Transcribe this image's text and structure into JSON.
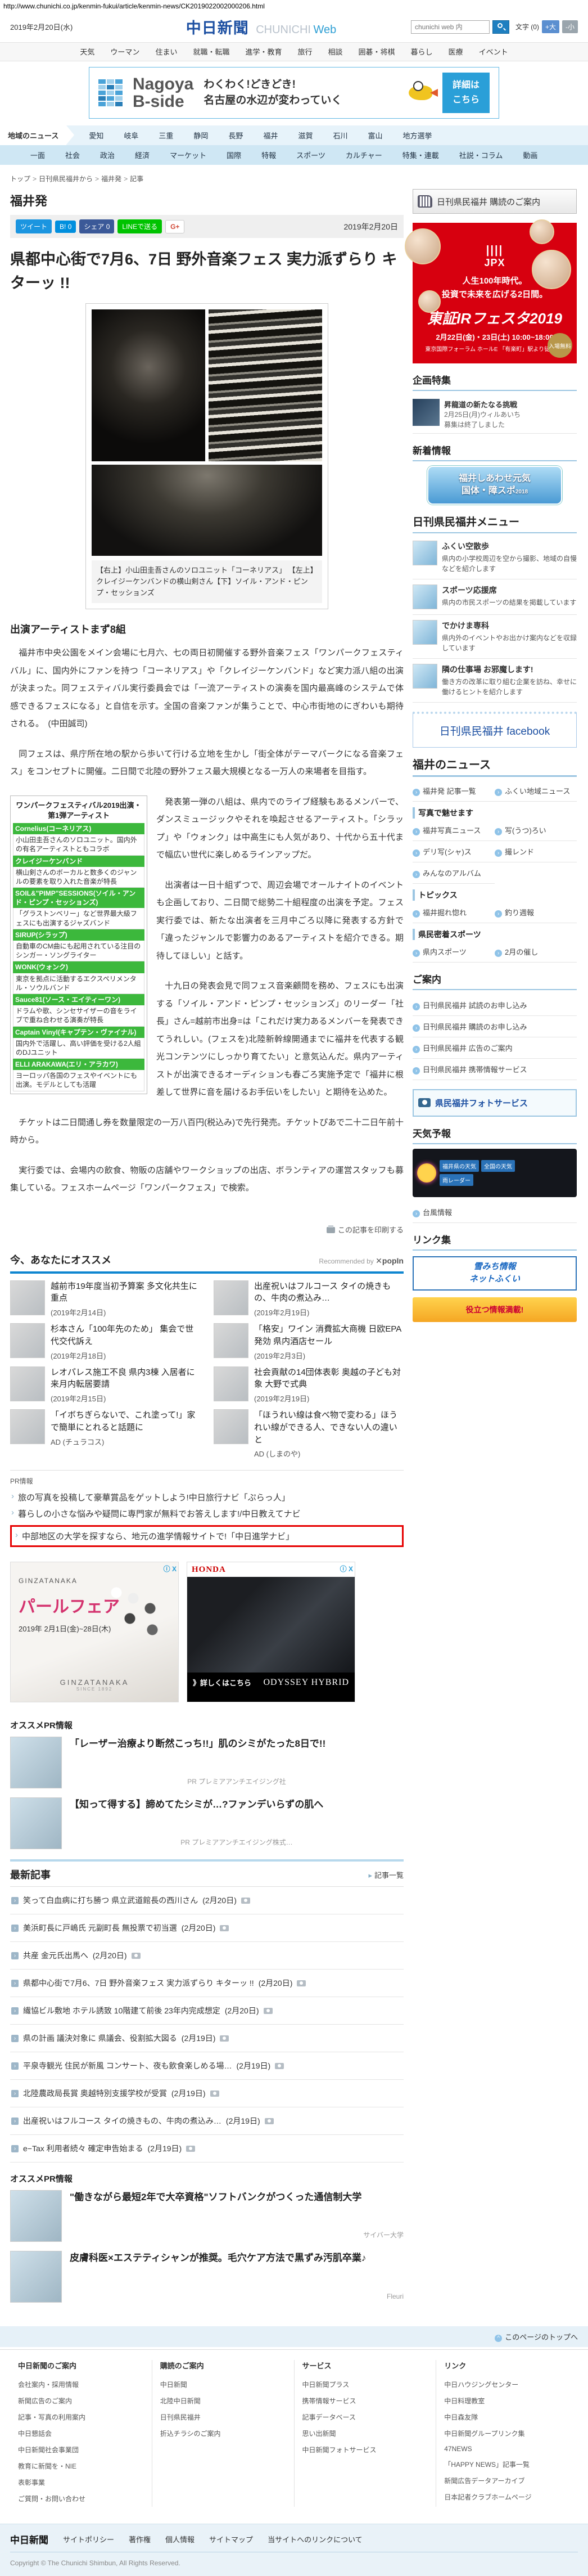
{
  "url": "http://www.chunichi.co.jp/kenmin-fukui/article/kenmin-news/CK2019022002000206.html",
  "header": {
    "date": "2019年2月20日(水)",
    "logo_main": "中日新聞",
    "logo_sub_gray": "CHUNICHI",
    "logo_sub_blue": "Web",
    "search_placeholder": "chunichi web 内",
    "font_label": "文字 (0)",
    "font_larger": "+大",
    "font_smaller": "-小"
  },
  "topnav": [
    "天気",
    "ウーマン",
    "住まい",
    "就職・転職",
    "進学・教育",
    "旅行",
    "相談",
    "囲碁・将棋",
    "暮らし",
    "医療",
    "イベント"
  ],
  "banner": {
    "logo_line1": "Nagoya",
    "logo_line2": "B-side",
    "copy1": "わくわく!どきどき!",
    "copy2": "名古屋の水辺が変わっていく",
    "button_line1": "詳細は",
    "button_line2": "こちら"
  },
  "regionnav": {
    "label": "地域のニュース",
    "items": [
      "愛知",
      "岐阜",
      "三重",
      "静岡",
      "長野",
      "福井",
      "滋賀",
      "石川",
      "富山",
      "地方選挙"
    ]
  },
  "catnav": [
    "一面",
    "社会",
    "政治",
    "経済",
    "マーケット",
    "国際",
    "特報",
    "スポーツ",
    "カルチャー",
    "特集・連載",
    "社説・コラム",
    "動画"
  ],
  "breadcrumb": [
    "トップ",
    "日刊県民福井から",
    "福井発",
    "記事"
  ],
  "page": {
    "section_title": "福井発",
    "date": "2019年2月20日"
  },
  "share": {
    "tweet": "ツイート",
    "hatena": "B! 0",
    "fb": "シェア 0",
    "line": "LINEで送る",
    "gplus": "G+"
  },
  "article": {
    "headline": "県都中心街で7月6、7日 野外音楽フェス 実力派ずらり キターッ !!",
    "caption": "【右上】小山田圭吾さんのソロユニット「コーネリアス」 【左上】クレイジーケンバンドの横山剣さん【下】ソイル・アンド・ピンプ・セッションズ",
    "subhead": "出演アーティストまず8組",
    "paragraphs": [
      "　福井市中央公園をメイン会場に七月六、七の両日初開催する野外音楽フェス「ワンパークフェスティバル」に、国内外にファンを持つ「コーネリアス」や「クレイジーケンバンド」など実力派八組の出演が決まった。同フェスティバル実行委員会では「一流アーティストの演奏を国内最高峰のシステムで体感できるフェスになる」と自信を示す。全国の音楽ファンが集うことで、中心市街地のにぎわいも期待される。　(中田誠司)",
      "　同フェスは、県庁所在地の駅から歩いて行ける立地を生かし「街全体がテーマパークになる音楽フェス」をコンセプトに開催。二日間で北陸の野外フェス最大規模となる一万人の来場者を目指す。",
      "　発表第一弾の八組は、県内でのライブ経験もあるメンバーで、ダンスミュージックやそれを喚起させるアーティスト。「シラップ」や「ウォンク」は中高生にも人気があり、十代から五十代まで幅広い世代に楽しめるラインアップだ。",
      "　出演者は一日十組ずつで、周辺会場でオールナイトのイベントも企画しており、二日間で総勢二十組程度の出演を予定。フェス実行委では、新たな出演者を三月中ごろ以降に発表する方針で「違ったジャンルで影響力のあるアーティストを紹介できる。期待してほしい」と話す。",
      "　十九日の発表会見で同フェス音楽顧問を務め、フェスにも出演する「ソイル・アンド・ピンプ・セッションズ」のリーダー「社長」さん=越前市出身=は「これだけ実力あるメンバーを発表できてうれしい。(フェスを)北陸新幹線開通までに福井を代表する観光コンテンツにしっかり育てたい」と意気込んだ。県内アーティストが出演できるオーディションも春ごろ実施予定で「福井に根差して世界に音を届けるお手伝いをしたい」と期待を込めた。",
      "　チケットは二日間通し券を数量限定の一万八百円(税込み)で先行発売。チケットぴあで二十二日午前十時から。",
      "　実行委では、会場内の飲食、物販の店舗やワークショップの出店、ボランティアの運営スタッフも募集している。フェスホームページ「ワンパークフェス」で検索。"
    ],
    "print_label": "この記事を印刷する"
  },
  "festival_table": {
    "title": "ワンパークフェスティバル2019出演・第1弾アーティスト",
    "acts": [
      {
        "name": "Cornelius(コーネリアス)",
        "desc": "小山田圭吾さんのソロユニット。国内外の有名アーティストともコラボ"
      },
      {
        "name": "クレイジーケンバンド",
        "desc": "横山剣さんのボーカルと数多くのジャンルの要素を取り入れた音楽が特長"
      },
      {
        "name": "SOIL&\"PIMP\"SESSIONS(ソイル・アンド・ピンプ・セッションズ)",
        "desc": "「グラストンベリー」など世界最大級フェスにも出演するジャズバンド"
      },
      {
        "name": "SIRUP(シラップ)",
        "desc": "自動車のCM曲にも起用されている注目のシンガー・ソングライター"
      },
      {
        "name": "WONK(ウォンク)",
        "desc": "東京を拠点に活動するエクスペリメンタル・ソウルバンド"
      },
      {
        "name": "Sauce81(ソース・エイティーワン)",
        "desc": "ドラムや歌、シンセサイザーの音をライブで重ね合わせる演奏が特長"
      },
      {
        "name": "Captain Vinyl(キャプテン・ヴァイナル)",
        "desc": "国内外で活躍し、高い評価を受ける2人組のDJユニット"
      },
      {
        "name": "ELLI ARAKAWA(エリ・アラカワ)",
        "desc": "ヨーロッパ各国のフェスやイベントにも出演。モデルとしても活躍"
      }
    ]
  },
  "recommend": {
    "title": "今、あなたにオススメ",
    "provider": "Recommended by",
    "provider_logo": "popIn",
    "items": [
      {
        "t": "越前市19年度当初予算案 多文化共生に重点",
        "d": "(2019年2月14日)"
      },
      {
        "t": "出産祝いはフルコース タイの焼きもの、牛肉の煮込み…",
        "d": "(2019年2月19日)"
      },
      {
        "t": "杉本さん「100年先のため」 集会で世代交代訴え",
        "d": "(2019年2月18日)"
      },
      {
        "t": "「格安」ワイン 消費拡大商機 日欧EPA発効 県内酒店セール",
        "d": "(2019年2月3日)"
      },
      {
        "t": "レオパレス施工不良 県内3棟 入居者に来月内転居要請",
        "d": "(2019年2月15日)"
      },
      {
        "t": "社会貢献の14団体表彰 奥越の子ども対象 大野で式典",
        "d": "(2019年2月19日)"
      },
      {
        "t": "「イボちぎらないで、これ塗って!」家で簡単にとれると話題に",
        "d": "AD (チュラコス)"
      },
      {
        "t": "「ほうれい線は食べ物で変わる」ほうれい線ができる人、できない人の違いと",
        "d": "AD (しまのや)"
      }
    ]
  },
  "pr_links": {
    "label": "PR情報",
    "items": [
      "旅の写真を投稿して豪華賞品をゲットしよう!中日旅行ナビ「ぷらっ人」",
      "暮らしの小さな悩みや疑問に専門家が無料でお答えします!/中日教えてナビ",
      "中部地区の大学を探すなら、地元の進学情報サイトで!「中日進学ナビ」"
    ]
  },
  "ads": {
    "pearl": {
      "brand": "GINZATANAKA",
      "title": "パールフェア",
      "period": "2019年 2月1日(金)~28日(木)",
      "foot": "GINZATANAKA",
      "foot_sub": "SINCE 1892",
      "ctl": "ⓘ X"
    },
    "honda": {
      "brand": "HONDA",
      "model": "ODYSSEY HYBRID",
      "cta": "》詳しくはこちら",
      "ctl": "ⓘ X"
    }
  },
  "pr_block1": {
    "title": "オススメPR情報",
    "items": [
      {
        "t": "「レーザー治療より断然こっち!!」肌のシミがたった8日で!!",
        "adv": "PR プレミアアンチエイジング社"
      },
      {
        "t": "【知って得する】諦めてたシミが…?ファンデいらずの肌へ",
        "adv": "PR プレミアアンチエイジング株式…"
      }
    ]
  },
  "pr_block2": {
    "title": "オススメPR情報",
    "items": [
      {
        "t": "\"働きながら最短2年で大卒資格\"ソフトバンクがつくった通信制大学",
        "adv": "サイバー大学"
      },
      {
        "t": "皮膚科医×エステティシャンが推奨。毛穴ケア方法で黒ずみ汚肌卒業♪",
        "adv": "Fleuri"
      }
    ]
  },
  "latest": {
    "title": "最新記事",
    "more": "記事一覧",
    "items": [
      {
        "t": "笑って白血病に打ち勝つ 県立武道館長の西川さん",
        "d": "(2月20日)"
      },
      {
        "t": "美浜町長に戸嶋氏 元副町長 無投票で初当選",
        "d": "(2月20日)"
      },
      {
        "t": "共産 金元氏出馬へ",
        "d": "(2月20日)"
      },
      {
        "t": "県都中心街で7月6、7日 野外音楽フェス 実力派ずらり キターッ !!",
        "d": "(2月20日)"
      },
      {
        "t": "繊協ビル敷地 ホテル誘致 10階建て前後 23年内完成想定",
        "d": "(2月20日)"
      },
      {
        "t": "県の計画 議決対象に 県議会、役割拡大図る",
        "d": "(2月19日)"
      },
      {
        "t": "平泉寺観光 住民が新風 コンサート、夜も飲食楽しめる場… ",
        "d": "(2月19日)"
      },
      {
        "t": "北陸農政局長賞 奥越特別支援学校が受賞",
        "d": "(2月19日)"
      },
      {
        "t": "出産祝いはフルコース タイの焼きもの、牛肉の煮込み…",
        "d": "(2月19日)"
      },
      {
        "t": "e−Tax 利用者続々 確定申告始まる",
        "d": "(2月19日)"
      }
    ]
  },
  "totop": "このページのトップへ",
  "sidebar": {
    "subscribe": {
      "line": "日刊県民福井 購読のご案内"
    },
    "jpx": {
      "logo": "JPX",
      "line1": "人生100年時代。",
      "line2": "投資で未来を広げる2日間。",
      "title": "東証IRフェスタ2019",
      "date": "2月22日(金)・23日(土) 10:00~18:00",
      "venue": "東京国際フォーラム ホールE",
      "access": "「有楽町」駅より徒歩1分",
      "badge": "入場無料"
    },
    "feature": {
      "title": "企画特集",
      "item_title": "昇龍道の新たなる挑戦",
      "item_line1": "2月25日(月)ウィルあいち",
      "item_line2": "募集は終了しました"
    },
    "whatsnew": {
      "title": "新着情報",
      "banner_line1": "福井しあわせ元気",
      "banner_line2": "国体・障スポ",
      "banner_year": "2018"
    },
    "menu": {
      "title": "日刊県民福井メニュー",
      "items": [
        {
          "t": "ふくい空散歩",
          "d": "県内の小学校周辺を空から撮影、地域の自慢などを紹介します"
        },
        {
          "t": "スポーツ応援席",
          "d": "県内の市民スポーツの結果を掲載しています"
        },
        {
          "t": "でかけま専科",
          "d": "県内外のイベントやお出かけ案内などを収録しています"
        },
        {
          "t": "隣の仕事場 お邪魔します!",
          "d": "働き方の改革に取り組む企業を訪ね、幸せに働けるヒントを紹介します"
        }
      ]
    },
    "facebook": "日刊県民福井 facebook",
    "news": {
      "title": "福井のニュース",
      "group1": [
        "福井発 記事一覧",
        "ふくい地域ニュース"
      ],
      "sub1": "写真で魅せます",
      "group2": [
        "福井写真ニュース",
        "写(うつ)ろい",
        "デリ写(シャ)ス",
        "撮レンド",
        "みんなのアルバム"
      ],
      "sub2": "トピックス",
      "group3": [
        "福井掘れ惚れ",
        "釣り週報"
      ],
      "sub3": "県民密着スポーツ",
      "group4": [
        "県内スポーツ",
        "2月の催し"
      ]
    },
    "guide": {
      "title": "ご案内",
      "links": [
        "日刊県民福井 試読のお申し込み",
        "日刊県民福井 購読のお申し込み",
        "日刊県民福井 広告のご案内",
        "日刊県民福井 携帯情報サービス"
      ]
    },
    "photo_service": "県民福井フォトサービス",
    "weather": {
      "title": "天気予報",
      "panels": [
        "福井県の天気",
        "全国の天気",
        "雨レーダー"
      ],
      "typhoon": "台風情報"
    },
    "links": {
      "title": "リンク集",
      "banner1_line1": "雪みち情報",
      "banner1_line2": "ネットふくい",
      "banner2": "役立つ情報満載!"
    }
  },
  "footer": {
    "columns": [
      {
        "header": "中日新聞のご案内",
        "items": [
          "会社案内・採用情報",
          "新聞広告のご案内",
          "記事・写真の利用案内",
          "中日懇話会",
          "中日新聞社会事業団",
          "教育に新聞を・NIE",
          "表彰事業",
          "ご質問・お問い合わせ"
        ]
      },
      {
        "header": "購読のご案内",
        "items": [
          "中日新聞",
          "北陸中日新聞",
          "日刊県民福井",
          "折込チラシのご案内"
        ]
      },
      {
        "header": "サービス",
        "items": [
          "中日新聞プラス",
          "携帯情報サービス",
          "記事データベース",
          "思い出新聞",
          "中日新聞フォトサービス"
        ]
      },
      {
        "header": "リンク",
        "items": [
          "中日ハウジングセンター",
          "中日料理教室",
          "中日森友隊",
          "中日新聞グループリンク集",
          "47NEWS",
          "「HAPPY NEWS」記事一覧",
          "新聞広告データアーカイブ",
          "日本記者クラブホームページ"
        ]
      }
    ],
    "logo": "中日新聞",
    "bottom_links": [
      "サイトポリシー",
      "著作権",
      "個人情報",
      "サイトマップ",
      "当サイトへのリンクについて"
    ],
    "copyright": "Copyright © The Chunichi Shimbun, All Rights Reserved."
  }
}
